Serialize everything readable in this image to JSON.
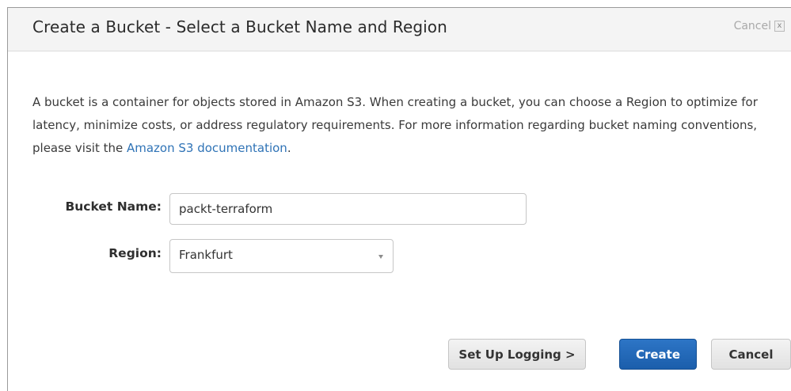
{
  "dialog": {
    "title": "Create a Bucket - Select a Bucket Name and Region",
    "cancel_link": "Cancel",
    "close_glyph": "x"
  },
  "description": {
    "text": "A bucket is a container for objects stored in Amazon S3. When creating a bucket, you can choose a Region to optimize for latency, minimize costs, or address regulatory requirements. For more information regarding bucket naming conventions, please visit the ",
    "link_text": "Amazon S3 documentation",
    "trailing": "."
  },
  "form": {
    "bucket_name_label": "Bucket Name:",
    "bucket_name_value": "packt-terraform",
    "region_label": "Region:",
    "region_value": "Frankfurt"
  },
  "buttons": {
    "setup_logging": "Set Up Logging >",
    "create": "Create",
    "cancel": "Cancel"
  },
  "colors": {
    "primary": "#1f63b3",
    "link": "#2f73b6"
  },
  "icons": {
    "close": "close-icon",
    "dropdown": "chevron-down-icon"
  }
}
